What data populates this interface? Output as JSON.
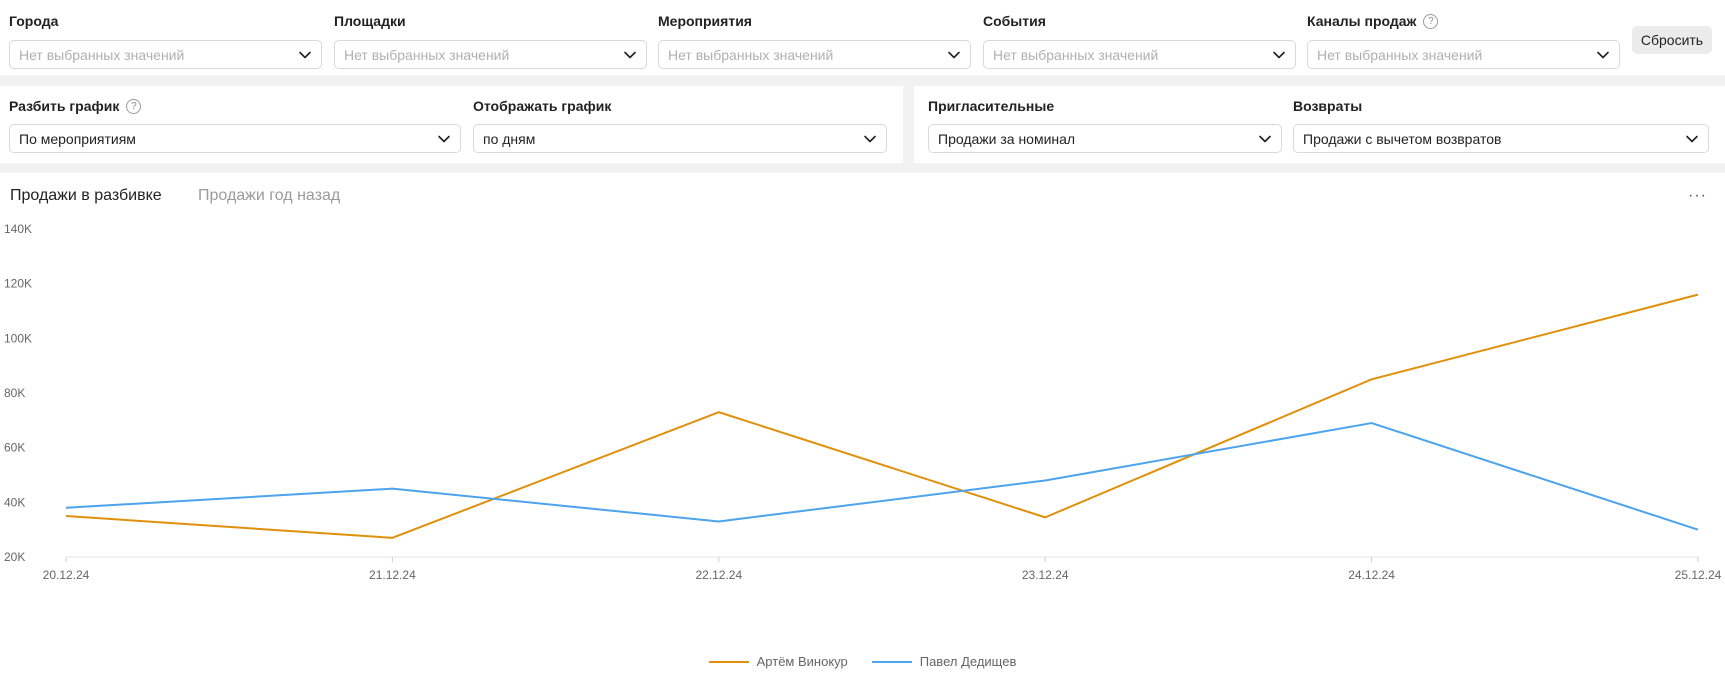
{
  "filters_row1": [
    {
      "label": "Города",
      "value": "Нет выбранных значений",
      "help": false
    },
    {
      "label": "Площадки",
      "value": "Нет выбранных значений",
      "help": false
    },
    {
      "label": "Мероприятия",
      "value": "Нет выбранных значений",
      "help": false
    },
    {
      "label": "События",
      "value": "Нет выбранных значений",
      "help": false
    },
    {
      "label": "Каналы продаж",
      "value": "Нет выбранных значений",
      "help": true
    }
  ],
  "reset_label": "Сбросить",
  "help_glyph": "?",
  "filters_row2": [
    {
      "label": "Разбить график",
      "value": "По мероприятиям",
      "help": true
    },
    {
      "label": "Отображать график",
      "value": "по дням",
      "help": false
    },
    {
      "label": "Пригласительные",
      "value": "Продажи за номинал",
      "help": false
    },
    {
      "label": "Возвраты",
      "value": "Продажи с вычетом возвратов",
      "help": false
    }
  ],
  "chart_tabs": [
    "Продажи в разбивке",
    "Продажи год назад"
  ],
  "more_label": "···",
  "colors": {
    "series1": "#E0900A",
    "series2": "#4DA3EC"
  },
  "chart_data": {
    "type": "line",
    "x": [
      "20.12.24",
      "21.12.24",
      "22.12.24",
      "23.12.24",
      "24.12.24",
      "25.12.24"
    ],
    "y_ticks": [
      "20K",
      "40K",
      "60K",
      "80K",
      "100K",
      "120K",
      "140K"
    ],
    "ylim": [
      20000,
      140000
    ],
    "series": [
      {
        "name": "Артём Винокур",
        "values": [
          35000,
          27000,
          73000,
          34500,
          85000,
          116000
        ]
      },
      {
        "name": "Павел Дедищев",
        "values": [
          38000,
          45000,
          33000,
          48000,
          69000,
          30000
        ]
      }
    ],
    "legend_position": "bottom-center",
    "grid": false
  }
}
